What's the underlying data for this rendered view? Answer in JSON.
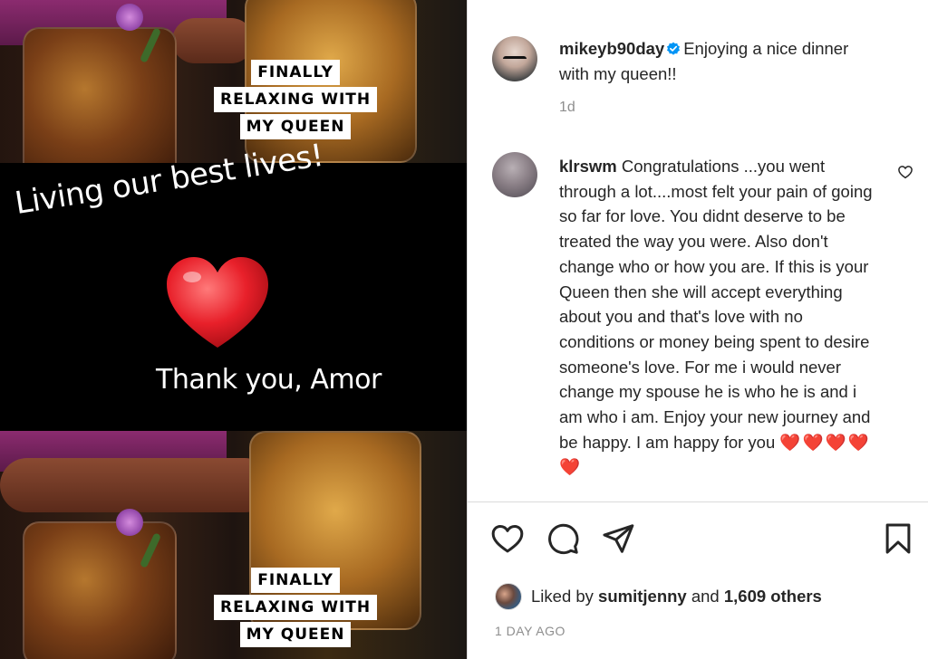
{
  "media": {
    "caption_lines": [
      "FINALLY",
      "RELAXING WITH",
      "MY QUEEN"
    ],
    "band_text": "Living our best lives!",
    "thanks_text": "Thank you, Amor"
  },
  "post": {
    "owner_username": "mikeyb90day",
    "owner_caption": "Enjoying a nice dinner with my queen!!",
    "time_ago": "1d"
  },
  "comment": {
    "username": "klrswm",
    "text": "Congratulations ...you went through a lot....most felt your pain of going so far for love. You didnt deserve to be treated the way you were. Also don't change who or how you are. If this is your Queen then she will accept everything about you and that's love with no conditions or money being spent to desire someone's love. For me i would never change my spouse he is who he is and i am who i am. Enjoy your new journey and be happy. I am happy for you",
    "hearts": "❤️❤️❤️❤️❤️"
  },
  "likes": {
    "prefix": "Liked by",
    "liker": "sumitjenny",
    "and": "and",
    "others": "1,609 others"
  },
  "date_label": "1 DAY AGO",
  "icons": {
    "like": "heart-outline-icon",
    "comment": "speech-bubble-icon",
    "share": "paper-plane-icon",
    "save": "bookmark-icon",
    "verified": "verified-badge-icon"
  },
  "colors": {
    "verified_blue": "#0095f6",
    "text_primary": "#262626",
    "text_secondary": "#8e8e8e",
    "heart_red": "#e0245e"
  }
}
